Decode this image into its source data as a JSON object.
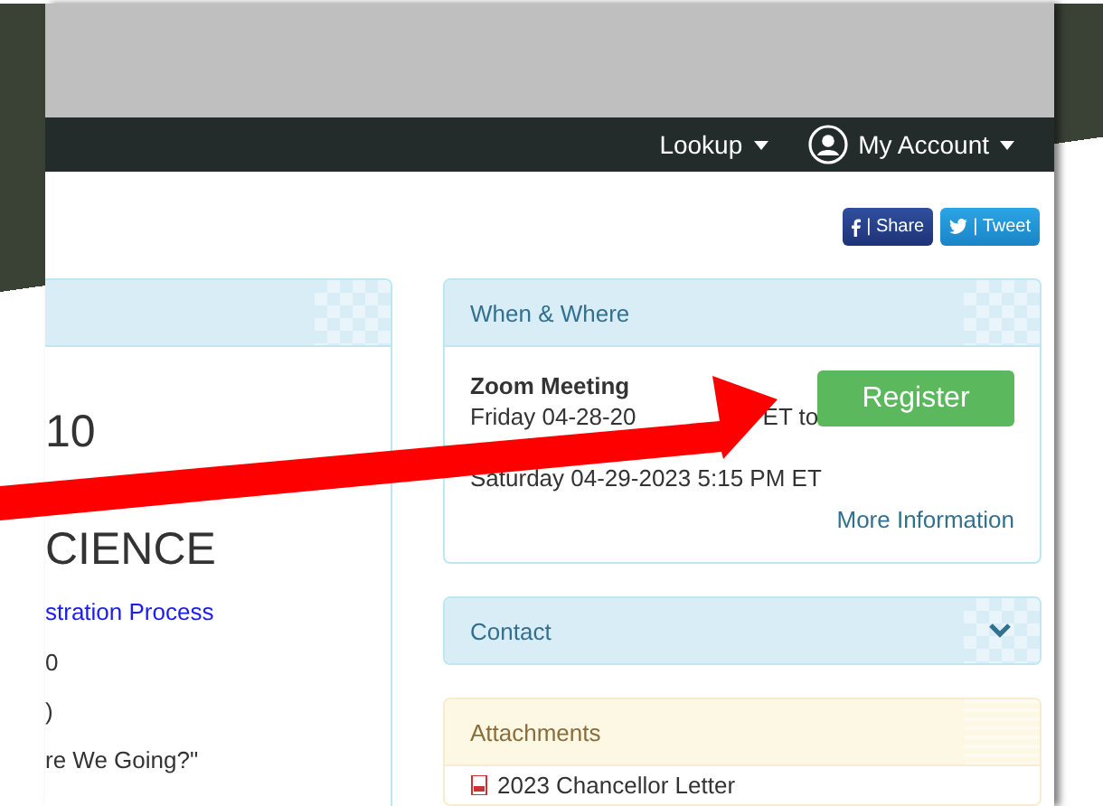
{
  "navbar": {
    "items": [
      {
        "label": "Lookup",
        "kind": "dropdown"
      },
      {
        "label": "My Account",
        "kind": "account"
      }
    ]
  },
  "share_buttons": [
    {
      "label": "| Share",
      "kind": "facebook"
    },
    {
      "label": "| Tweet",
      "kind": "twitter"
    }
  ],
  "left_panel": {
    "lines": [
      {
        "text": "10",
        "kind": "title"
      },
      {
        "text": "CIENCE",
        "kind": "title"
      },
      {
        "text": "stration Process",
        "kind": "link"
      },
      {
        "text": "0",
        "kind": "text"
      },
      {
        "text": ")",
        "kind": "text"
      },
      {
        "text": "re We Going?\"",
        "kind": "text"
      }
    ]
  },
  "when_where": {
    "title": "When & Where",
    "event": "Zoom Meeting",
    "date_start": "Friday 04-28-20",
    "date_start_end": "ET to",
    "date_end": "Saturday 04-29-2023 5:15 PM ET",
    "button": "Register",
    "link": "More Information"
  },
  "contact": {
    "title": "Contact",
    "expanded": false
  },
  "attachments": {
    "title": "Attachments",
    "items": [
      "2023 Chancellor Letter"
    ]
  }
}
